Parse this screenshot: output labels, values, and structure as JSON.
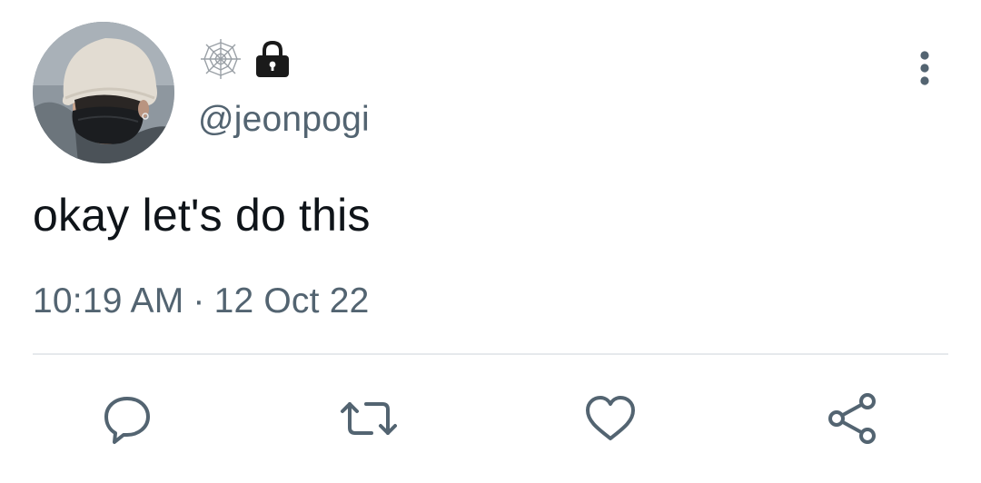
{
  "tweet": {
    "handle": "@jeonpogi",
    "text": "okay let's do this",
    "time": "10:19 AM",
    "separator": "·",
    "date": "12 Oct 22"
  },
  "icons": {
    "avatar": "profile-photo",
    "name_emoji_1": "spider-web-icon",
    "name_emoji_2": "lock-icon",
    "more": "vertical-ellipsis-icon",
    "reply": "speech-bubble-icon",
    "retweet": "retweet-icon",
    "like": "heart-icon",
    "share": "share-icon"
  },
  "colors": {
    "text_primary": "#0f1419",
    "text_secondary": "#536471",
    "divider": "#e6e9ec",
    "icon": "#536471"
  }
}
